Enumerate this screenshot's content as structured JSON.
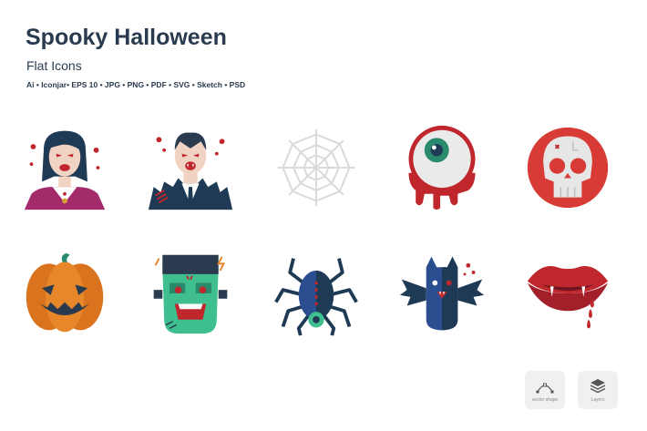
{
  "header": {
    "title": "Spooky Halloween",
    "subtitle": "Flat Icons",
    "formats": "Ai • Iconjar• EPS 10 • JPG • PNG • PDF • SVG • Sketch • PSD"
  },
  "icons": [
    {
      "name": "vampire-woman-icon"
    },
    {
      "name": "dracula-icon"
    },
    {
      "name": "spider-web-icon"
    },
    {
      "name": "bloody-eyeball-icon"
    },
    {
      "name": "skull-icon"
    },
    {
      "name": "jack-o-lantern-icon"
    },
    {
      "name": "frankenstein-icon"
    },
    {
      "name": "spider-icon"
    },
    {
      "name": "bat-icon"
    },
    {
      "name": "vampire-lips-icon"
    }
  ],
  "badges": [
    {
      "label": "vector shape",
      "icon": "vector-shape-icon"
    },
    {
      "label": "Layers",
      "icon": "layers-icon"
    }
  ],
  "colors": {
    "heading": "#2a3b4f",
    "blood": "#c0272d",
    "pumpkin": "#e8862a",
    "frankenstein": "#3fbf8f",
    "navy": "#1f3a55"
  }
}
